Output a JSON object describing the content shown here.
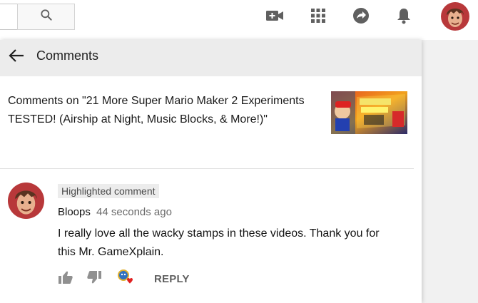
{
  "masthead": {
    "icons": [
      "search-icon",
      "video-camera-plus-icon",
      "apps-grid-icon",
      "share-arrow-icon",
      "bell-icon"
    ],
    "colors": {
      "icon": "#606060",
      "background": "#ffffff"
    }
  },
  "panel": {
    "header": {
      "title": "Comments",
      "back_icon": "arrow-left-icon"
    },
    "video": {
      "info": "Comments on \"21 More Super Mario Maker 2 Experiments TESTED! (Airship at Night, Music Blocks, & More!)\""
    },
    "comment": {
      "badge": "Highlighted comment",
      "author": "Bloops",
      "time": "44 seconds ago",
      "text": "I really love all the wacky stamps in these videos. Thank you for this Mr. GameXplain.",
      "actions": {
        "reply": "REPLY",
        "icons": [
          "thumbs-up-icon",
          "thumbs-down-icon",
          "creator-heart-icon"
        ]
      }
    }
  }
}
